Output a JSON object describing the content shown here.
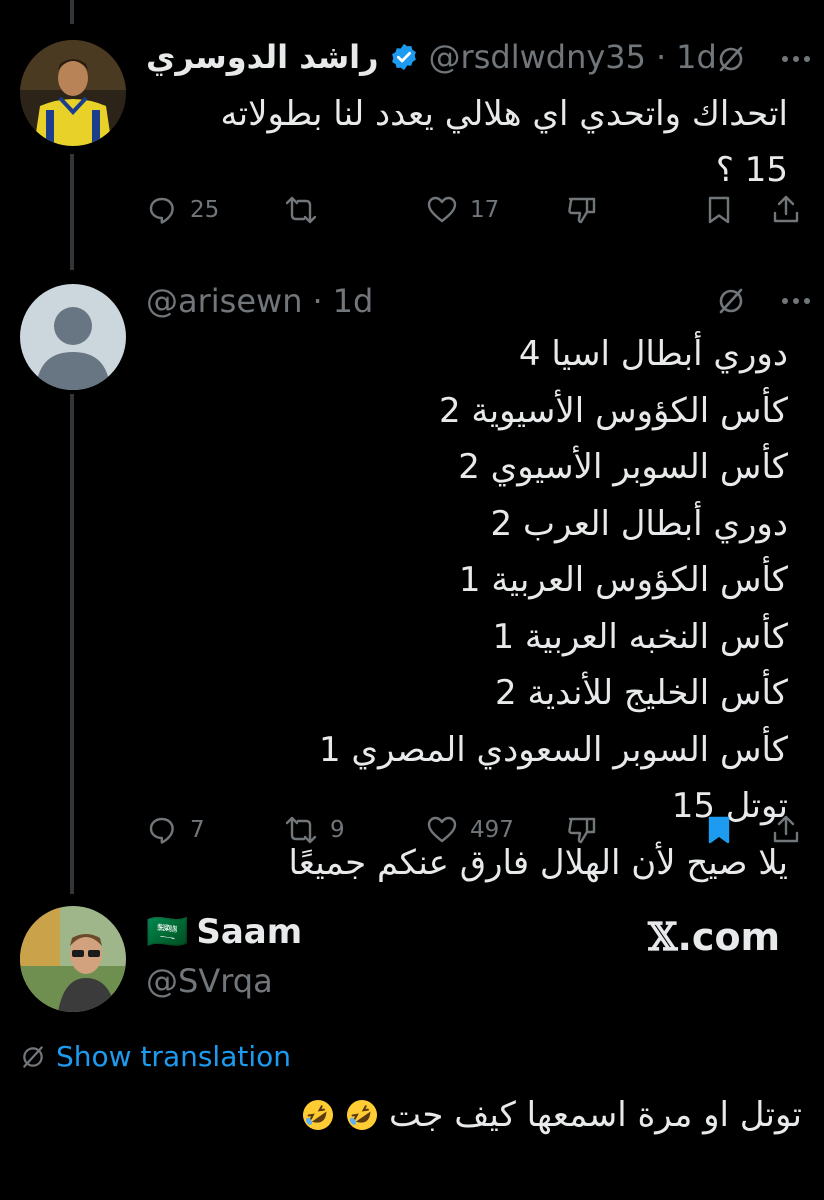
{
  "tweet1": {
    "display_name": "راشد الدوسري",
    "handle": "@rsdlwdny35",
    "time": "1d",
    "separator": "·",
    "text_line1": "اتحداك واتحدي اي هلالي يعدد لنا بطولاته",
    "text_line2": "15 ؟",
    "replies": "25",
    "retweets": "",
    "likes": "17"
  },
  "tweet2": {
    "handle": "@arisewn",
    "time": "1d",
    "separator": "·",
    "lines": [
      "دوري أبطال اسيا 4",
      "كأس الكؤوس الأسيوية 2",
      "كأس السوبر الأسيوي 2",
      "دوري أبطال العرب 2",
      "كأس الكؤوس العربية 1",
      "كأس النخبه العربية 1",
      "كأس الخليج للأندية 2",
      "كأس السوبر السعودي المصري 1",
      "توتل 15",
      "يلا صيح لأن الهلال فارق عنكم جميعًا"
    ],
    "replies": "7",
    "retweets": "9",
    "likes": "497"
  },
  "tweet3": {
    "display_name": "Saam",
    "flag": "🇸🇦",
    "handle": "@SVrqa",
    "watermark_x": "𝕏",
    "watermark_rest": ".com",
    "show_translation": "Show translation",
    "text": "توتل او مرة اسمعها كيف جت",
    "emojis": [
      "rolling-on-floor-laughing",
      "rolling-on-floor-laughing"
    ]
  },
  "colors": {
    "background": "#000000",
    "text": "#e7e9ea",
    "muted": "#71767b",
    "accent": "#1d9bf0",
    "thread_line": "#333639"
  }
}
